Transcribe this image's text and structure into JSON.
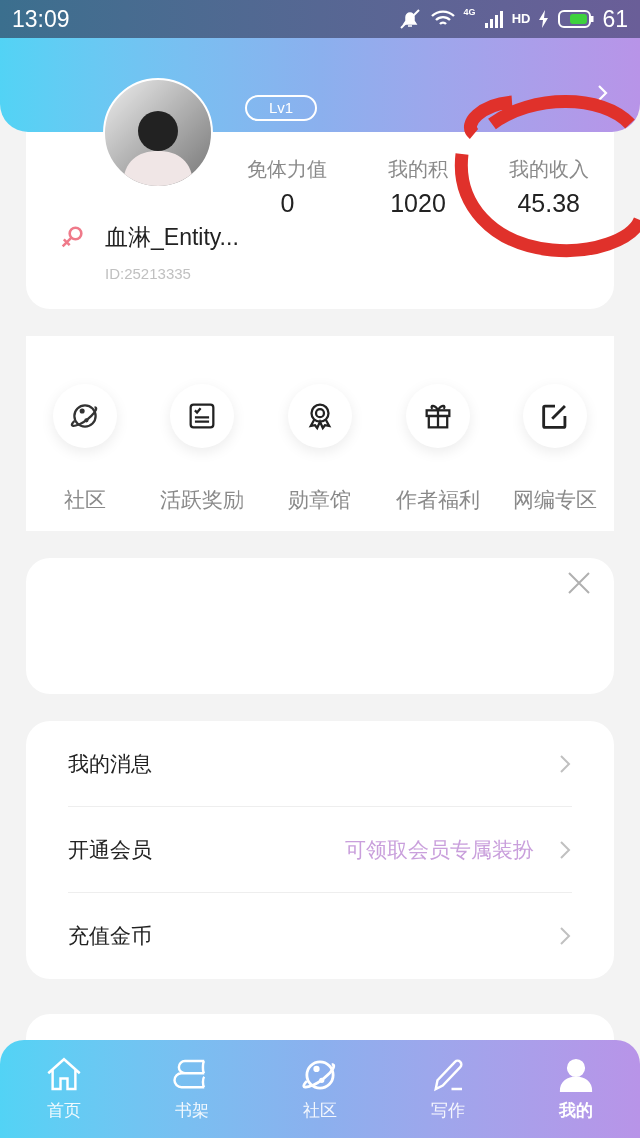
{
  "status_bar": {
    "time": "13:09",
    "network": "4G",
    "hd": "HD",
    "battery": "61"
  },
  "header": {
    "level_badge": "Lv1"
  },
  "profile": {
    "name": "血淋_Entity...",
    "id": "ID:25213335",
    "stats": [
      {
        "label": "免体力值",
        "value": "0"
      },
      {
        "label": "我的积",
        "value": "1020"
      },
      {
        "label": "我的收入",
        "value": "45.38"
      }
    ]
  },
  "shortcuts": [
    {
      "kind": "planet",
      "label": "社区"
    },
    {
      "kind": "checklist",
      "label": "活跃奖励"
    },
    {
      "kind": "medal",
      "label": "勋章馆"
    },
    {
      "kind": "gift",
      "label": "作者福利"
    },
    {
      "kind": "edit",
      "label": "网编专区"
    }
  ],
  "ad_card": {
    "closable": true
  },
  "menu": [
    {
      "label": "我的消息"
    },
    {
      "label": "开通会员",
      "hint": "可领取会员专属装扮"
    },
    {
      "label": "充值金币"
    }
  ],
  "tab_bar": [
    {
      "kind": "home",
      "label": "首页",
      "selected": false
    },
    {
      "kind": "shelf",
      "label": "书架",
      "selected": false
    },
    {
      "kind": "planet",
      "label": "社区",
      "selected": false
    },
    {
      "kind": "pen",
      "label": "写作",
      "selected": false
    },
    {
      "kind": "user",
      "label": "我的",
      "selected": true
    }
  ]
}
